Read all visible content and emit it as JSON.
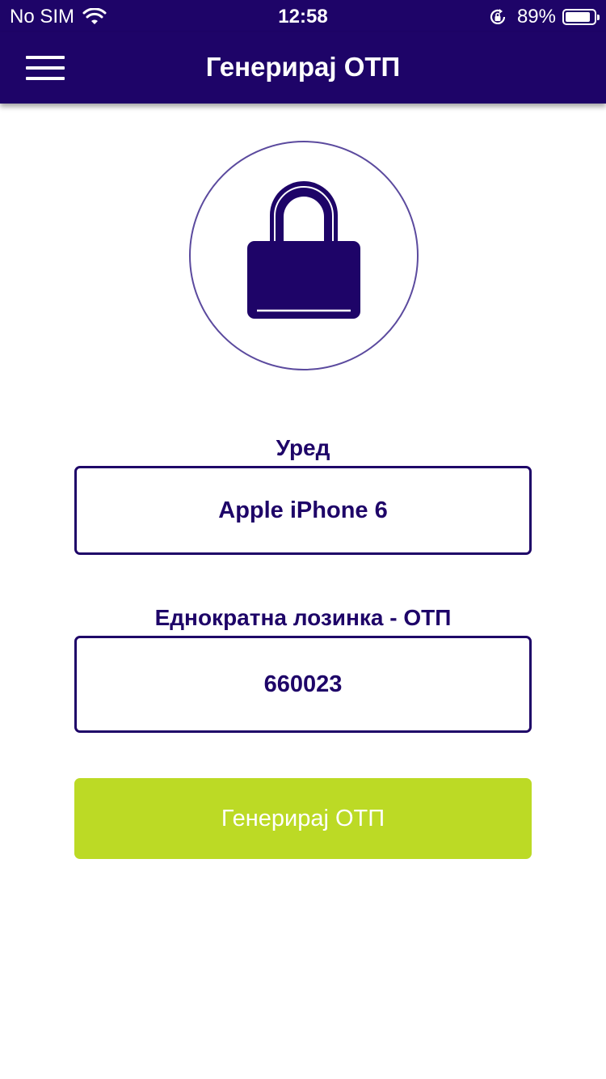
{
  "status_bar": {
    "carrier": "No SIM",
    "time": "12:58",
    "battery_percent": "89%",
    "battery_level": 0.89
  },
  "nav": {
    "title": "Генерирај ОТП"
  },
  "device_field": {
    "label": "Уред",
    "value": "Apple iPhone 6"
  },
  "otp_field": {
    "label": "Еднократна лозинка - ОТП",
    "value": "660023"
  },
  "generate_button": {
    "label": "Генерирај ОТП"
  },
  "colors": {
    "primary": "#1e0468",
    "accent": "#bcda25",
    "background": "#ffffff"
  },
  "icons": {
    "menu": "hamburger-menu-icon",
    "lock": "lock-icon",
    "wifi": "wifi-icon",
    "rotation_lock": "rotation-lock-icon",
    "battery": "battery-icon"
  }
}
